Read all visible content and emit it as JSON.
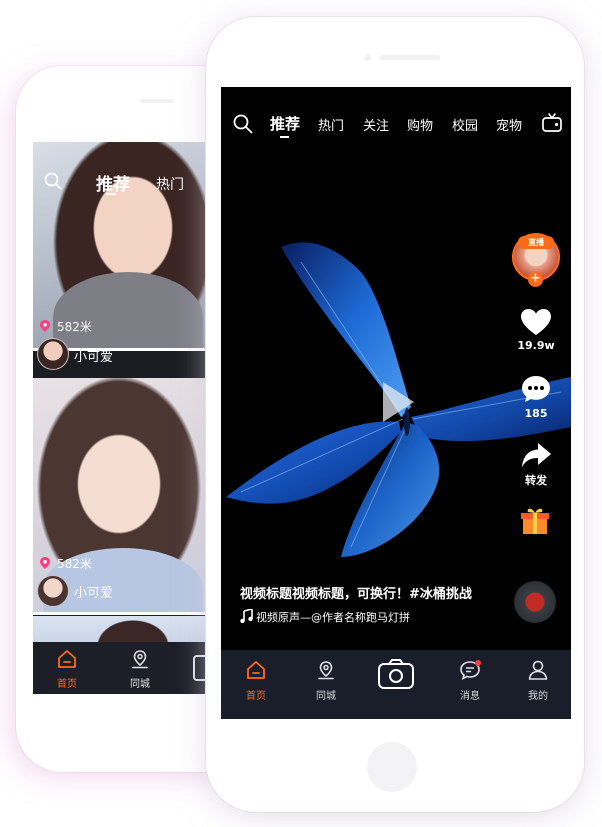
{
  "back_phone": {
    "tabs": [
      "推荐",
      "热门"
    ],
    "cards": [
      {
        "distance": "582米",
        "name": "小可爱"
      },
      {
        "distance": "582米",
        "name": "小可爱"
      }
    ],
    "nav": [
      {
        "label": "首页",
        "icon": "home-icon",
        "active": true
      },
      {
        "label": "同城",
        "icon": "location-icon",
        "active": false
      }
    ]
  },
  "front_phone": {
    "tabs": [
      "推荐",
      "热门",
      "关注",
      "购物",
      "校园",
      "宠物"
    ],
    "active_tab": "推荐",
    "live_badge": "直播",
    "likes": "19.9w",
    "comments": "185",
    "share_label": "转发",
    "caption": "视频标题视频标题，可换行！#冰桶挑战",
    "music": "视频原声—@作者名称跑马灯拼",
    "nav": [
      {
        "label": "首页",
        "icon": "home-icon",
        "active": true
      },
      {
        "label": "同城",
        "icon": "location-icon",
        "active": false
      },
      {
        "label": "",
        "icon": "camera-icon",
        "active": false
      },
      {
        "label": "消息",
        "icon": "message-icon",
        "active": false
      },
      {
        "label": "我的",
        "icon": "profile-icon",
        "active": false
      }
    ]
  },
  "colors": {
    "accent": "#ff6a1a",
    "pin": "#ff3d7f",
    "butterfly": "#1f6fe0",
    "nav_bg": "#1a1e2a"
  }
}
